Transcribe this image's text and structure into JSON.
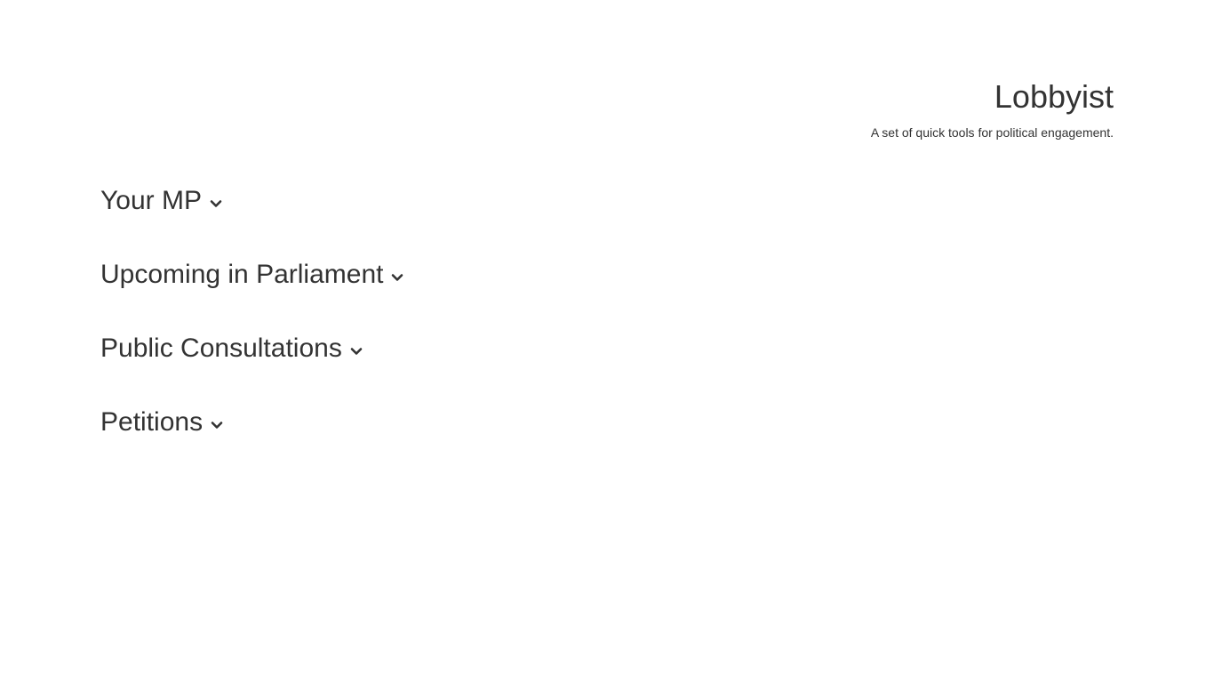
{
  "header": {
    "title": "Lobbyist",
    "tagline": "A set of quick tools for political engagement."
  },
  "sections": [
    {
      "label": "Your MP",
      "icon": "chevron-down-icon"
    },
    {
      "label": "Upcoming in Parliament",
      "icon": "chevron-down-icon"
    },
    {
      "label": "Public Consultations",
      "icon": "chevron-down-icon"
    },
    {
      "label": "Petitions",
      "icon": "chevron-down-icon"
    }
  ],
  "colors": {
    "text": "#333333",
    "background": "#ffffff"
  }
}
